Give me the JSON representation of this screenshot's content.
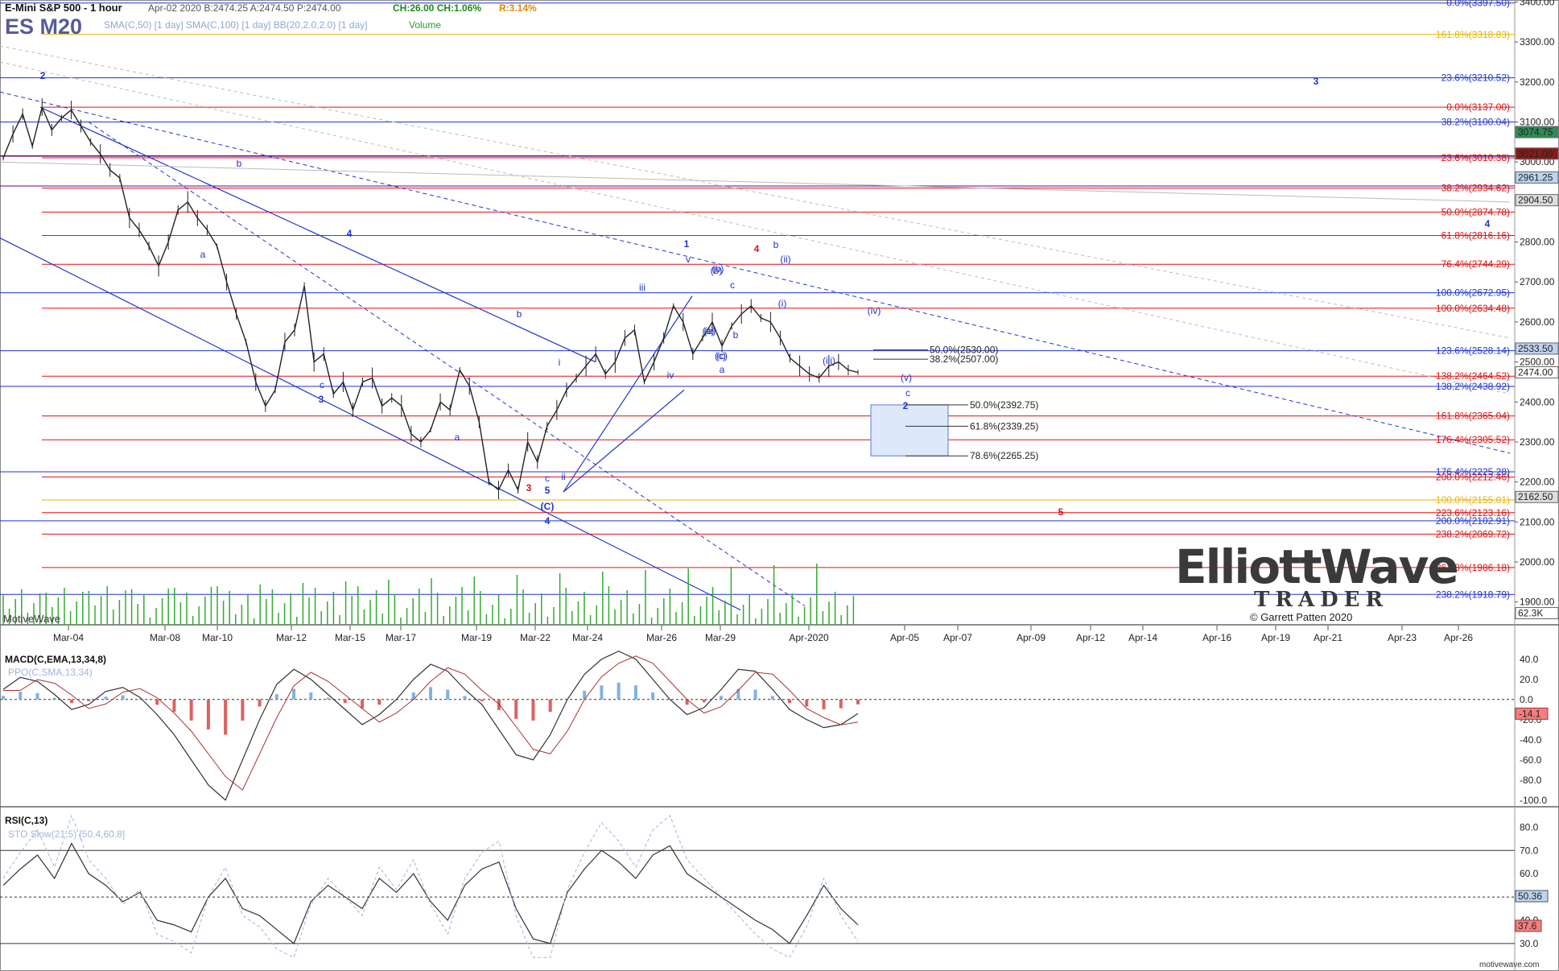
{
  "header": {
    "title": "E-Mini S&P 500 - 1 hour",
    "quote": "Apr-02 2020  B:2474.25  A:2474.50  P:2474.00",
    "change": "CH:26.00  CH:1.06%",
    "range": "R:3.14%",
    "symbol": "ES M20",
    "indicators": "SMA(C,50) [1 day]  SMA(C,100) [1 day]  BB(20,2.0,2.0) [1 day]",
    "volume_label": "Volume"
  },
  "watermark": {
    "brand_top": "ElliottWave",
    "brand_bottom": "TRADER",
    "copyright": "© Garrett Patten 2020",
    "motivewave": "MotiveWave",
    "footer": "motivewave.com"
  },
  "colors": {
    "blue": "#1f35d1",
    "red": "#e01010",
    "orange": "#e8b400",
    "purple": "#700070",
    "price": "#222222",
    "volume": "#33aa33",
    "macd_pos": "#7fb2e6",
    "macd_neg": "#e06060"
  },
  "chart_data": [
    {
      "type": "line",
      "name": "price-panel",
      "title": "E-Mini S&P 500 - 1 hour",
      "ylabel": "",
      "ylim": [
        1855,
        3405
      ],
      "y_ticks": [
        1900,
        2000,
        2100,
        2200,
        2300,
        2400,
        2500,
        2600,
        2700,
        2800,
        2900,
        3000,
        3100,
        3200,
        3300,
        3400
      ],
      "x_ticks": [
        "Mar-04",
        "Mar-08",
        "Mar-10",
        "Mar-12",
        "Mar-15",
        "Mar-17",
        "Mar-19",
        "Mar-22",
        "Mar-24",
        "Mar-26",
        "Mar-29",
        "Apr-2020",
        "Apr-05",
        "Apr-07",
        "Apr-09",
        "Apr-12",
        "Apr-14",
        "Apr-16",
        "Apr-19",
        "Apr-21",
        "Apr-23",
        "Apr-26"
      ],
      "series": [
        {
          "values": [
            3010,
            3070,
            3120,
            3040,
            3137,
            3080,
            3110,
            3130,
            3090,
            3050,
            3020,
            2980,
            2960,
            2860,
            2830,
            2790,
            2740,
            2800,
            2880,
            2900,
            2860,
            2830,
            2790,
            2700,
            2620,
            2550,
            2450,
            2390,
            2430,
            2550,
            2580,
            2690,
            2500,
            2520,
            2420,
            2450,
            2380,
            2450,
            2460,
            2390,
            2410,
            2390,
            2320,
            2300,
            2330,
            2400,
            2380,
            2480,
            2440,
            2350,
            2200,
            2180,
            2230,
            2180,
            2300,
            2250,
            2340,
            2380,
            2430,
            2460,
            2490,
            2520,
            2470,
            2500,
            2560,
            2580,
            2450,
            2500,
            2560,
            2640,
            2600,
            2520,
            2560,
            2600,
            2540,
            2590,
            2620,
            2640,
            2610,
            2600,
            2560,
            2510,
            2490,
            2470,
            2460,
            2490,
            2500,
            2480,
            2474
          ]
        }
      ],
      "horizontal_levels": [
        {
          "label": "0.0%(3397.50)",
          "value": 3397.5,
          "color": "blue"
        },
        {
          "label": "161.8%(3318.83)",
          "value": 3318.83,
          "color": "orange"
        },
        {
          "label": "23.6%(3210.52)",
          "value": 3210.52,
          "color": "blue"
        },
        {
          "label": "0.0%(3137.00)",
          "value": 3137.0,
          "color": "red"
        },
        {
          "label": "38.2%(3100.04)",
          "value": 3100.04,
          "color": "blue"
        },
        {
          "label": "23.6%(3010.38)",
          "value": 3010.38,
          "color": "red"
        },
        {
          "label": "38.2%(2934.62)",
          "value": 2934.62,
          "color": "red"
        },
        {
          "label": "50.0%(2874.78)",
          "value": 2874.78,
          "color": "red"
        },
        {
          "label": "61.8%(2816.16)",
          "value": 2816.16,
          "color": "red"
        },
        {
          "label": "76.4%(2744.29)",
          "value": 2744.29,
          "color": "red"
        },
        {
          "label": "100.0%(2672.95)",
          "value": 2672.95,
          "color": "blue"
        },
        {
          "label": "100.0%(2634.48)",
          "value": 2634.48,
          "color": "red"
        },
        {
          "label": "123.6%(2528.14)",
          "value": 2528.14,
          "color": "blue"
        },
        {
          "label": "138.2%(2464.52)",
          "value": 2464.52,
          "color": "red"
        },
        {
          "label": "138.2%(2438.92)",
          "value": 2438.92,
          "color": "blue"
        },
        {
          "label": "161.8%(2365.04)",
          "value": 2365.04,
          "color": "red"
        },
        {
          "label": "176.4%(2305.52)",
          "value": 2305.52,
          "color": "red"
        },
        {
          "label": "176.4%(2225.28)",
          "value": 2225.28,
          "color": "blue"
        },
        {
          "label": "200.0%(2212.46)",
          "value": 2212.46,
          "color": "red"
        },
        {
          "label": "100.0%(2155.01)",
          "value": 2155.01,
          "color": "orange"
        },
        {
          "label": "223.6%(2123.16)",
          "value": 2123.16,
          "color": "red"
        },
        {
          "label": "200.0%(2102.91)",
          "value": 2102.91,
          "color": "blue"
        },
        {
          "label": "238.2%(2069.72)",
          "value": 2069.72,
          "color": "red"
        },
        {
          "label": "261.8%(1986.18)",
          "value": 1986.18,
          "color": "red"
        },
        {
          "label": "238.2%(1918.79)",
          "value": 1918.79,
          "color": "blue"
        }
      ],
      "retracement_labels": [
        {
          "label": "50.0%(2530.00)",
          "value": 2530.0
        },
        {
          "label": "38.2%(2507.00)",
          "value": 2507.0
        },
        {
          "label": "50.0%(2392.75)",
          "value": 2392.75
        },
        {
          "label": "61.8%(2339.25)",
          "value": 2339.25
        },
        {
          "label": "78.6%(2265.25)",
          "value": 2265.25
        }
      ],
      "price_badges": [
        {
          "label": "3074.75",
          "value": 3074.75,
          "bg": "#2e8b57",
          "fg": "#ffffff"
        },
        {
          "label": "3021.00",
          "value": 3021.0,
          "bg": "#8b1a1a",
          "fg": "#ffffff"
        },
        {
          "label": "2961.25",
          "value": 2961.25,
          "bg": "#bcd4ee",
          "fg": "#000000"
        },
        {
          "label": "2904.50",
          "value": 2904.5,
          "bg": "#dddddd",
          "fg": "#000000"
        },
        {
          "label": "2533.50",
          "value": 2533.5,
          "bg": "#bcd4ee",
          "fg": "#000000"
        },
        {
          "label": "2474.00",
          "value": 2474.0,
          "bg": "#ffffff",
          "fg": "#000000"
        },
        {
          "label": "2162.50",
          "value": 2162.5,
          "bg": "#dddddd",
          "fg": "#000000"
        },
        {
          "label": "62.3K",
          "value": 1872,
          "bg": "#ffffff",
          "fg": "#000000"
        }
      ],
      "wave_labels": [
        "2",
        "b",
        "a",
        "4",
        "c",
        "3",
        "a",
        "b",
        "3",
        "c",
        "5",
        "(C)",
        "4",
        "ii",
        "i",
        "iii",
        "iv",
        "v",
        "1",
        "(a)",
        "(b)",
        "(c)",
        "a",
        "b",
        "c",
        "(a)",
        "(b)",
        "(c)",
        "4",
        "b",
        "(i)",
        "(ii)",
        "(iii)",
        "(iv)",
        "(v)",
        "c",
        "2",
        "3",
        "4",
        "5"
      ]
    },
    {
      "type": "line",
      "name": "macd-panel",
      "title": "MACD(C,EMA,13,34,8)",
      "subtitle": "PPO(C,SMA,13,34)",
      "ylim": [
        -105,
        55
      ],
      "y_ticks": [
        40.0,
        20.0,
        0.0,
        -20.0,
        -40.0,
        -60.0,
        -80.0,
        -100.0
      ],
      "current_label": "-14.1",
      "series": [
        {
          "name": "MACD",
          "values": [
            10,
            22,
            18,
            5,
            -10,
            -5,
            8,
            12,
            2,
            -15,
            -35,
            -60,
            -85,
            -100,
            -60,
            -20,
            15,
            30,
            20,
            5,
            -10,
            -25,
            -15,
            0,
            20,
            35,
            28,
            10,
            -5,
            -30,
            -55,
            -60,
            -35,
            0,
            25,
            40,
            48,
            40,
            20,
            0,
            -15,
            -8,
            10,
            30,
            28,
            10,
            -10,
            -20,
            -28,
            -25,
            -14
          ]
        }
      ]
    },
    {
      "type": "line",
      "name": "rsi-panel",
      "title": "RSI(C,13)",
      "subtitle": "STO Slow(21,5) [50.4,60.8]",
      "ylim": [
        22,
        86
      ],
      "y_ticks": [
        80.0,
        70.0,
        60.0,
        50.0,
        40.0,
        30.0
      ],
      "current_labels": [
        "50.36",
        "37.6"
      ],
      "series": [
        {
          "name": "RSI",
          "values": [
            55,
            62,
            68,
            58,
            73,
            60,
            55,
            48,
            52,
            40,
            38,
            35,
            50,
            58,
            45,
            42,
            36,
            30,
            48,
            55,
            50,
            45,
            58,
            52,
            60,
            48,
            40,
            55,
            62,
            65,
            45,
            32,
            30,
            52,
            62,
            70,
            65,
            58,
            68,
            72,
            60,
            55,
            50,
            45,
            40,
            36,
            30,
            42,
            55,
            45,
            38
          ]
        }
      ]
    }
  ]
}
